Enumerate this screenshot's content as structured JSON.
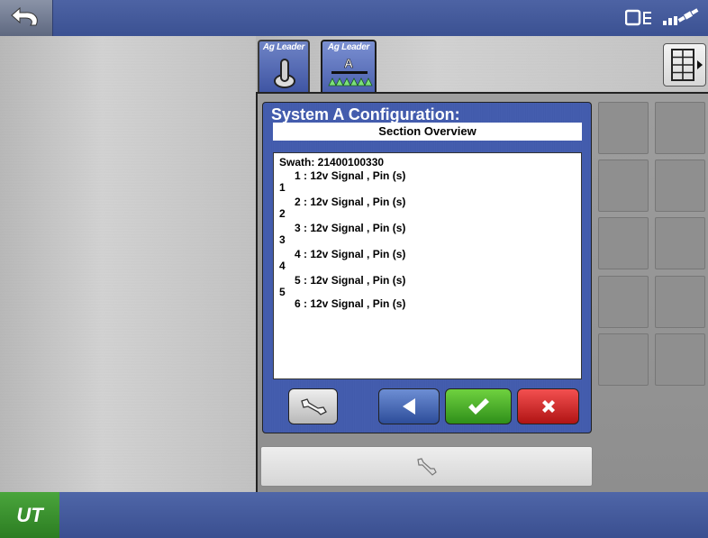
{
  "topbar": {
    "back_icon": "undo-arrow-icon",
    "status_icons": [
      "display-toggle-icon",
      "gps-signal-icon"
    ]
  },
  "tabs": [
    {
      "brand": "Ag Leader",
      "icon": "toggle-switch-icon"
    },
    {
      "brand": "Ag Leader",
      "icon": "sprayer-boom-icon",
      "badge": "A"
    }
  ],
  "dialog": {
    "title": "System A Configuration:",
    "subtitle": "Section Overview",
    "swath": "Swath: 21400100330",
    "sections": [
      {
        "num": "1",
        "text": "1 :  12v Signal ,  Pin (s)"
      },
      {
        "num": "2",
        "text": "2 :  12v Signal ,  Pin (s)"
      },
      {
        "num": "3",
        "text": "3 :  12v Signal ,  Pin (s)"
      },
      {
        "num": "4",
        "text": "4 :  12v Signal ,  Pin (s)"
      },
      {
        "num": "5",
        "text": "5 :  12v Signal ,  Pin (s)"
      },
      {
        "num": "",
        "text": "6 :  12v Signal ,  Pin (s)"
      }
    ]
  },
  "bottombar": {
    "ut_label": "UT"
  },
  "colors": {
    "accent_blue": "#3f55a3",
    "ok_green": "#2f8f1a",
    "cancel_red": "#b01414"
  }
}
